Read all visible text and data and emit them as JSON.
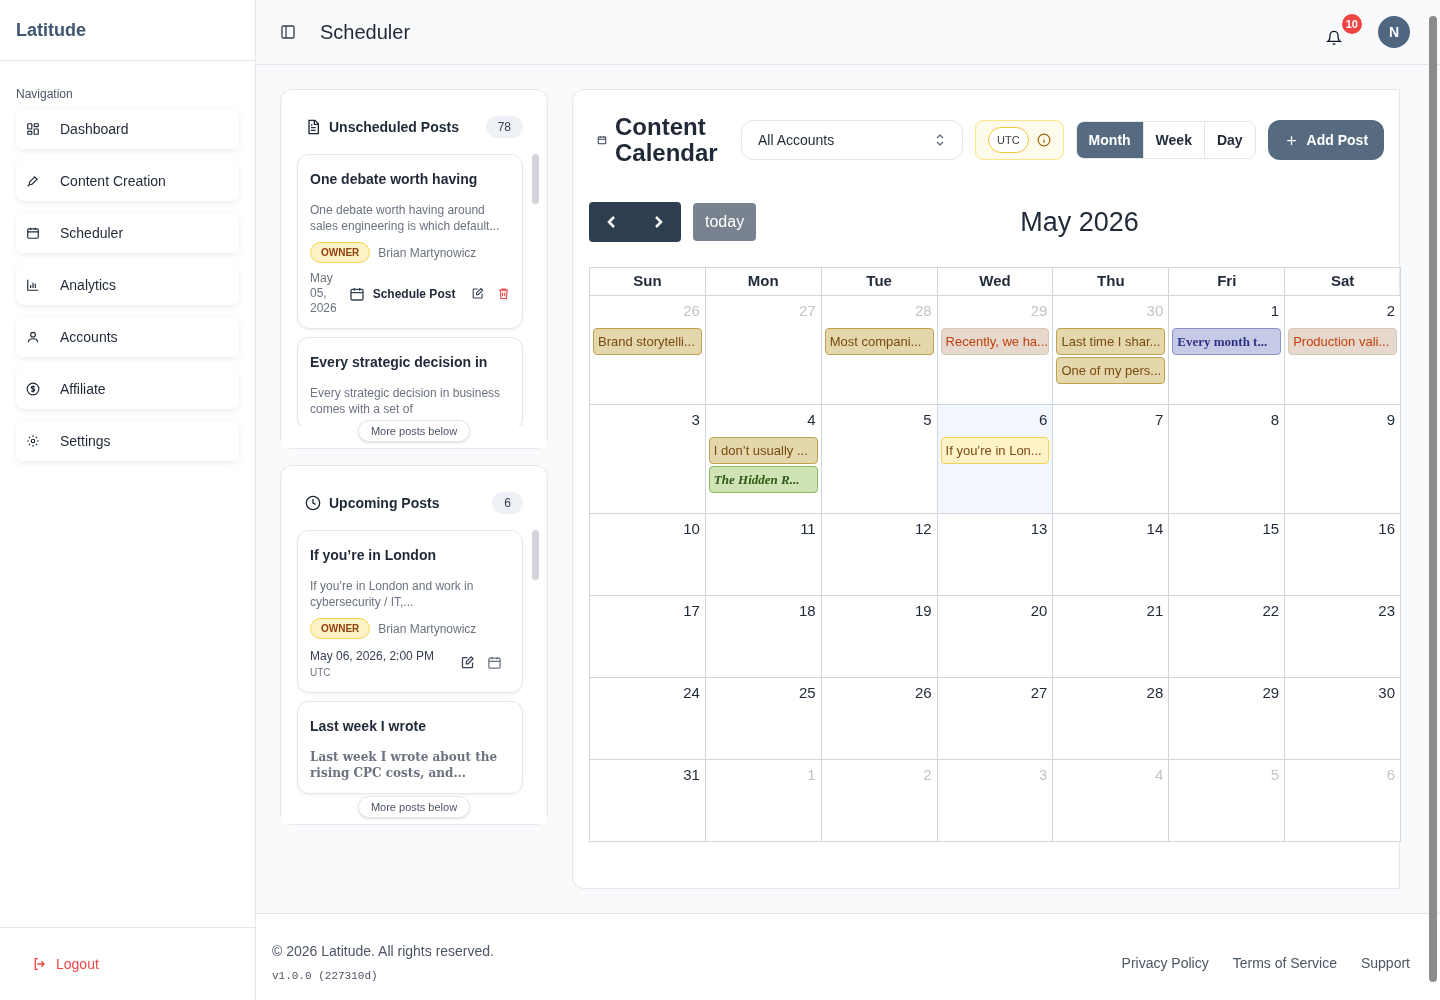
{
  "brand": "Latitude",
  "sidebar": {
    "heading": "Navigation",
    "items": [
      {
        "label": "Dashboard",
        "selected": false
      },
      {
        "label": "Content Creation",
        "selected": false
      },
      {
        "label": "Scheduler",
        "selected": false
      },
      {
        "label": "Analytics",
        "selected": false
      },
      {
        "label": "Accounts",
        "selected": false
      },
      {
        "label": "Affiliate",
        "selected": false
      },
      {
        "label": "Settings",
        "selected": false
      }
    ],
    "logout": "Logout"
  },
  "header": {
    "title": "Scheduler",
    "notifications": "10",
    "avatar": "N"
  },
  "unscheduled": {
    "title": "Unscheduled Posts",
    "count": "78",
    "more": "More posts below",
    "posts": [
      {
        "kind": "plain",
        "title": "One debate worth having",
        "excerpt": "One debate worth having around sales engineering is which default...",
        "role": "OWNER",
        "author": "Brian Martynowicz",
        "date": "May 05, 2026",
        "action": "Schedule Post"
      },
      {
        "kind": "plain",
        "title": "Every strategic decision in",
        "excerpt": "Every strategic decision in business comes with a set of"
      }
    ]
  },
  "upcoming": {
    "title": "Upcoming Posts",
    "count": "6",
    "more": "More posts below",
    "posts": [
      {
        "kind": "plain",
        "title": "If you’re in London",
        "excerpt": "If you’re in London and work in cybersecurity / IT,...",
        "role": "OWNER",
        "author": "Brian Martynowicz",
        "date": "May 06, 2026, 2:00 PM",
        "tz": "UTC"
      },
      {
        "kind": "serif",
        "title": "Last week I wrote",
        "excerpt": "Last week I wrote about the rising CPC costs, and..."
      }
    ]
  },
  "calendar": {
    "title": "Content Calendar",
    "account": "All Accounts",
    "timezone": "UTC",
    "views": [
      {
        "label": "Month",
        "selected": true
      },
      {
        "label": "Week",
        "selected": false
      },
      {
        "label": "Day",
        "selected": false
      }
    ],
    "add": "Add Post",
    "today": "today",
    "month": "May 2026",
    "weekdays": [
      "Sun",
      "Mon",
      "Tue",
      "Wed",
      "Thu",
      "Fri",
      "Sat"
    ],
    "weeks": [
      [
        {
          "day": "26",
          "muted": true,
          "today": false,
          "events": [
            {
              "text": "Brand storytelli...",
              "kind": "plain",
              "color": "#e3d7ab"
            }
          ]
        },
        {
          "day": "27",
          "muted": true,
          "today": false
        },
        {
          "day": "28",
          "muted": true,
          "today": false,
          "events": [
            {
              "text": "Most compani...",
              "kind": "plain",
              "color": "#e3d7ab"
            }
          ]
        },
        {
          "day": "29",
          "muted": true,
          "today": false,
          "events": [
            {
              "text": "Recently, we ha...",
              "kind": "plain",
              "color": "#e6d8cc"
            }
          ]
        },
        {
          "day": "30",
          "muted": true,
          "today": false,
          "events": [
            {
              "text": "Last time I shar...",
              "kind": "plain",
              "color": "#e3d7ab"
            },
            {
              "text": "One of my pers...",
              "kind": "plain",
              "color": "#e3d7ab"
            }
          ]
        },
        {
          "day": "1",
          "muted": false,
          "today": false,
          "events": [
            {
              "text": "Every month t...",
              "kind": "serif-bold",
              "color": "#c5cbe6"
            }
          ]
        },
        {
          "day": "2",
          "muted": false,
          "today": false,
          "events": [
            {
              "text": "Production vali...",
              "kind": "plain",
              "color": "#e6d8cc"
            }
          ]
        }
      ],
      [
        {
          "day": "3",
          "muted": false,
          "today": false
        },
        {
          "day": "4",
          "muted": false,
          "today": false,
          "events": [
            {
              "text": "I don’t usually ...",
              "kind": "plain",
              "color": "#e3d7ab"
            },
            {
              "text": "The Hidden R...",
              "kind": "serif-bold-italic",
              "color": "#cfe3b5"
            }
          ]
        },
        {
          "day": "5",
          "muted": false,
          "today": false
        },
        {
          "day": "6",
          "muted": false,
          "today": true,
          "events": [
            {
              "text": "If you’re in Lon...",
              "kind": "plain",
              "color": "#fef3c7"
            }
          ]
        },
        {
          "day": "7",
          "muted": false,
          "today": false
        },
        {
          "day": "8",
          "muted": false,
          "today": false
        },
        {
          "day": "9",
          "muted": false,
          "today": false
        }
      ],
      [
        {
          "day": "10",
          "muted": false,
          "today": false
        },
        {
          "day": "11",
          "muted": false,
          "today": false
        },
        {
          "day": "12",
          "muted": false,
          "today": false
        },
        {
          "day": "13",
          "muted": false,
          "today": false
        },
        {
          "day": "14",
          "muted": false,
          "today": false
        },
        {
          "day": "15",
          "muted": false,
          "today": false
        },
        {
          "day": "16",
          "muted": false,
          "today": false
        }
      ],
      [
        {
          "day": "17",
          "muted": false,
          "today": false
        },
        {
          "day": "18",
          "muted": false,
          "today": false
        },
        {
          "day": "19",
          "muted": false,
          "today": false
        },
        {
          "day": "20",
          "muted": false,
          "today": false
        },
        {
          "day": "21",
          "muted": false,
          "today": false
        },
        {
          "day": "22",
          "muted": false,
          "today": false
        },
        {
          "day": "23",
          "muted": false,
          "today": false
        }
      ],
      [
        {
          "day": "24",
          "muted": false,
          "today": false
        },
        {
          "day": "25",
          "muted": false,
          "today": false
        },
        {
          "day": "26",
          "muted": false,
          "today": false
        },
        {
          "day": "27",
          "muted": false,
          "today": false
        },
        {
          "day": "28",
          "muted": false,
          "today": false
        },
        {
          "day": "29",
          "muted": false,
          "today": false
        },
        {
          "day": "30",
          "muted": false,
          "today": false
        }
      ],
      [
        {
          "day": "31",
          "muted": false,
          "today": false
        },
        {
          "day": "1",
          "muted": true,
          "today": false
        },
        {
          "day": "2",
          "muted": true,
          "today": false
        },
        {
          "day": "3",
          "muted": true,
          "today": false
        },
        {
          "day": "4",
          "muted": true,
          "today": false
        },
        {
          "day": "5",
          "muted": true,
          "today": false
        },
        {
          "day": "6",
          "muted": true,
          "today": false
        }
      ]
    ]
  },
  "footer": {
    "copyright": "© 2026 Latitude. All rights reserved.",
    "version": "v1.0.0 (227310d)",
    "links": [
      "Privacy Policy",
      "Terms of Service",
      "Support"
    ]
  }
}
